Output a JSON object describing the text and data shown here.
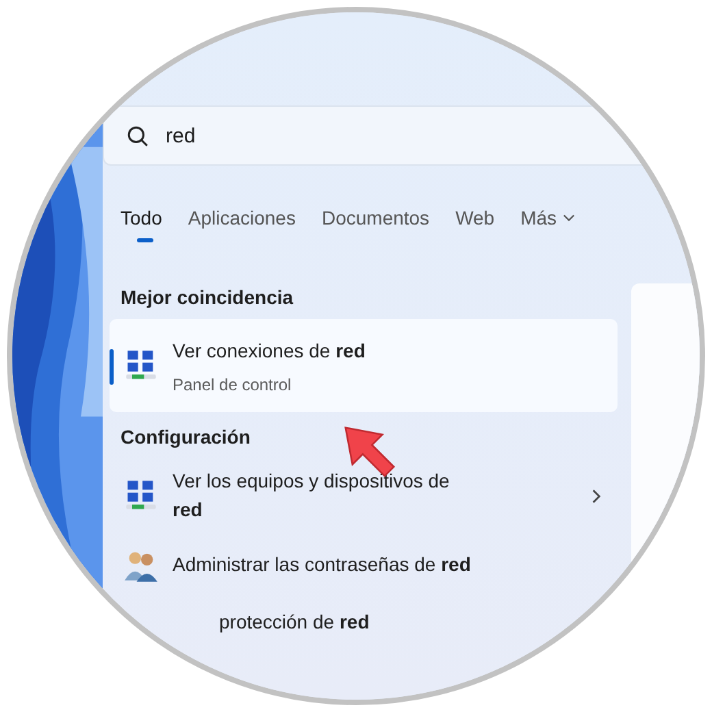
{
  "search": {
    "value": "red"
  },
  "tabs": [
    {
      "label": "Todo",
      "selected": true,
      "dropdown": false
    },
    {
      "label": "Aplicaciones",
      "selected": false,
      "dropdown": false
    },
    {
      "label": "Documentos",
      "selected": false,
      "dropdown": false
    },
    {
      "label": "Web",
      "selected": false,
      "dropdown": false
    },
    {
      "label": "Más",
      "selected": false,
      "dropdown": true
    }
  ],
  "sections": [
    {
      "heading": "Mejor coincidencia",
      "items": [
        {
          "kind": "network",
          "title": "Ver conexiones de **red**",
          "subtitle": "Panel de control",
          "selected": true,
          "chevron": false
        }
      ]
    },
    {
      "heading": "Configuración",
      "items": [
        {
          "kind": "network",
          "title": "Ver los equipos y dispositivos de **red**",
          "selected": false,
          "chevron": true
        },
        {
          "kind": "users",
          "title": "Administrar las contraseñas de **red**",
          "selected": false,
          "chevron": false
        },
        {
          "kind": "none",
          "title": "protección de **red**",
          "selected": false
        }
      ]
    }
  ]
}
